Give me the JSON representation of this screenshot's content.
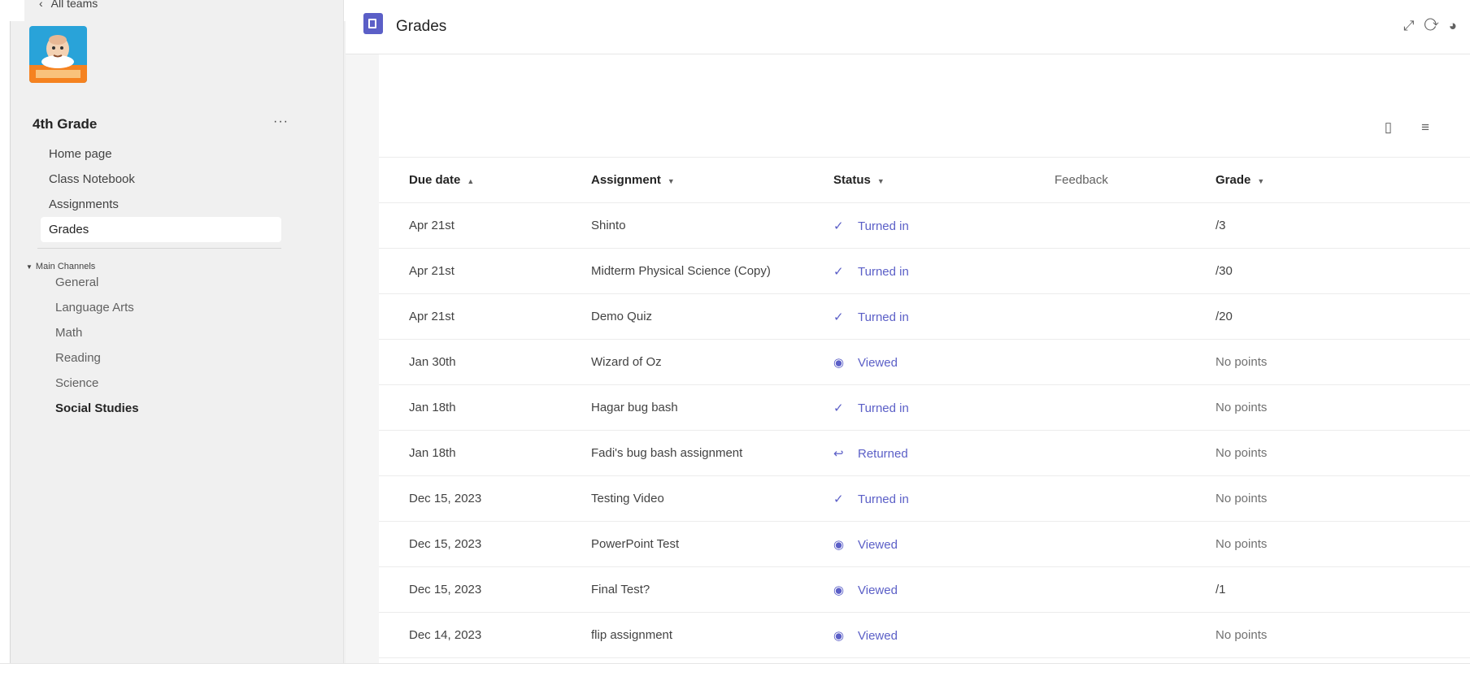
{
  "sidebar": {
    "back_label": "All teams",
    "team_name": "4th Grade",
    "more": "···",
    "nav": [
      "Home page",
      "Class Notebook",
      "Assignments",
      "Grades"
    ],
    "active_nav": 3,
    "section_label": "Main Channels",
    "channels": [
      "General",
      "Language Arts",
      "Math",
      "Reading",
      "Science",
      "Social Studies"
    ],
    "active_channel": 5
  },
  "header": {
    "title": "Grades"
  },
  "table": {
    "columns": [
      "Due date",
      "Assignment",
      "Status",
      "Feedback",
      "Grade"
    ],
    "rows": [
      {
        "due": "Apr 21st",
        "assignment": "Shinto",
        "status": "Turned in",
        "status_icon": "check-icon",
        "grade": "/3"
      },
      {
        "due": "Apr 21st",
        "assignment": "Midterm Physical Science (Copy)",
        "status": "Turned in",
        "status_icon": "check-icon",
        "grade": "/30"
      },
      {
        "due": "Apr 21st",
        "assignment": "Demo Quiz",
        "status": "Turned in",
        "status_icon": "check-icon",
        "grade": "/20"
      },
      {
        "due": "Jan 30th",
        "assignment": "Wizard of Oz",
        "status": "Viewed",
        "status_icon": "eye-icon",
        "grade": "No points"
      },
      {
        "due": "Jan 18th",
        "assignment": "Hagar bug bash",
        "status": "Turned in",
        "status_icon": "check-icon",
        "grade": "No points"
      },
      {
        "due": "Jan 18th",
        "assignment": "Fadi's bug bash assignment",
        "status": "Returned",
        "status_icon": "return-arrow-icon",
        "grade": "No points"
      },
      {
        "due": "Dec 15, 2023",
        "assignment": "Testing Video",
        "status": "Turned in",
        "status_icon": "check-icon",
        "grade": "No points"
      },
      {
        "due": "Dec 15, 2023",
        "assignment": "PowerPoint Test",
        "status": "Viewed",
        "status_icon": "eye-icon",
        "grade": "No points"
      },
      {
        "due": "Dec 15, 2023",
        "assignment": "Final Test?",
        "status": "Viewed",
        "status_icon": "eye-icon",
        "grade": "/1"
      },
      {
        "due": "Dec 14, 2023",
        "assignment": "flip assignment",
        "status": "Viewed",
        "status_icon": "eye-icon",
        "grade": "No points"
      }
    ]
  },
  "colors": {
    "accent": "#5b5fc7"
  }
}
